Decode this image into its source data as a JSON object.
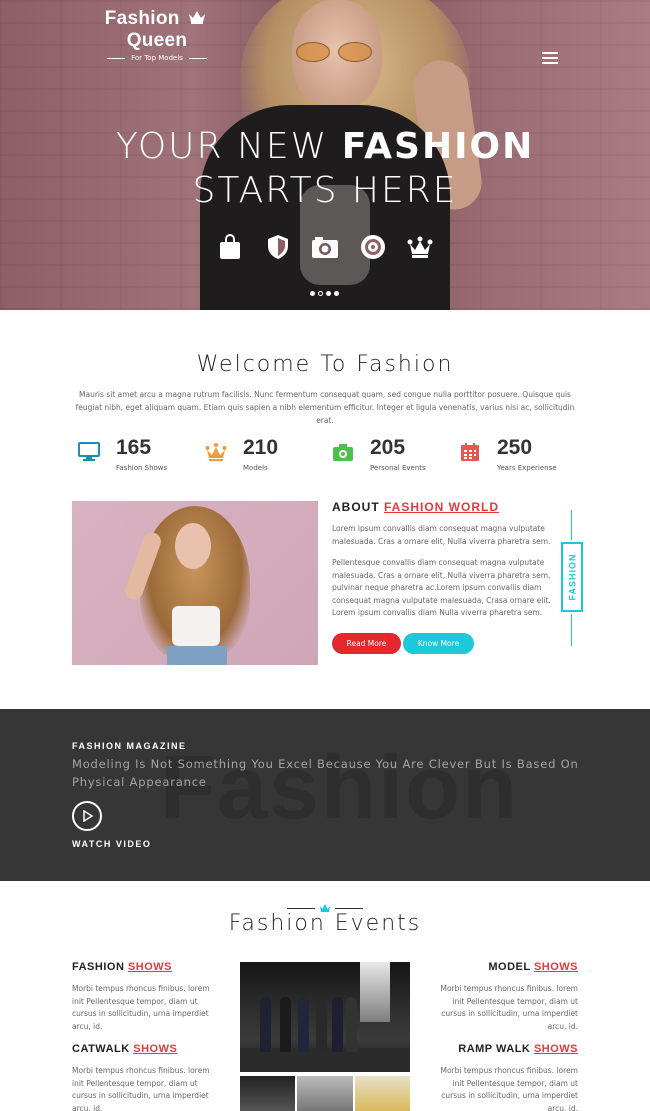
{
  "header": {
    "brand_left": "Fashion",
    "brand_right": "Queen",
    "tagline": "For Top Models"
  },
  "hero": {
    "title_line1_light": "YOUR NEW ",
    "title_line1_bold": "FASHION",
    "title_line2": "STARTS HERE",
    "icons": [
      "shopping-bag-icon",
      "shield-icon",
      "camera-icon",
      "target-icon",
      "crown-icon"
    ],
    "slides": 4,
    "active_slide": 2
  },
  "welcome": {
    "title": "Welcome To Fashion",
    "text": "Mauris sit amet arcu a magna rutrum facilisis. Nunc fermentum consequat quam, sed congue nulla porttitor posuere. Quisque quis feugiat nibh, eget aliquam quam. Etiam quis sapien a nibh elementum efficitur. Integer et ligula venenatis, varius nisi ac, sollicitudin erat."
  },
  "stats": [
    {
      "icon": "monitor-icon",
      "number": "165",
      "label": "Fashion Shows",
      "color": "#1b8db8"
    },
    {
      "icon": "crown-icon",
      "number": "210",
      "label": "Models",
      "color": "#f39c33"
    },
    {
      "icon": "camera-icon",
      "number": "205",
      "label": "Personal Events",
      "color": "#4cbf4f"
    },
    {
      "icon": "calendar-icon",
      "number": "250",
      "label": "Years Experiense",
      "color": "#e6584e"
    }
  ],
  "about": {
    "title_plain": "ABOUT ",
    "title_link": "FASHION WORLD",
    "para1": "Lorem ipsum convallis diam consequat magna vulputate malesuada. Cras a ornare elit, Nulla viverra pharetra sem.",
    "para2": "Pellentesque convallis diam consequat magna vulputate malesuada. Cras a ornare elit, Nulla viverra pharetra sem, pulvinar neque pharetra ac.Lorem ipsum convallis diam consequat magna vulputate malesuada, Crasa ornare elit. Lorem ipsum convallis diam Nulla viverra pharetra sem.",
    "read_more": "Read More",
    "know_more": "Know More",
    "side_label": "FASHION"
  },
  "magazine": {
    "kicker": "FASHION MAGAZINE",
    "text": "Modeling Is Not Something You Excel Because You Are Clever But Is Based On Physical Appearance",
    "watch": "WATCH VIDEO",
    "bg_word": "Fashion"
  },
  "events": {
    "title": "Fashion Events",
    "items": [
      {
        "plain": "FASHION ",
        "link": "SHOWS",
        "text": "Morbi tempus rhoncus finibus. lorem init Pellentesque tempor, diam ut cursus in sollicitudin, urna imperdiet arcu, id."
      },
      {
        "plain": "MODEL ",
        "link": "SHOWS",
        "text": "Morbi tempus rhoncus finibus. lorem init Pellentesque tempor, diam ut cursus in sollicitudin, urna imperdiet arcu, id."
      },
      {
        "plain": "CATWALK ",
        "link": "SHOWS",
        "text": "Morbi tempus rhoncus finibus. lorem init Pellentesque tempor, diam ut cursus in sollicitudin, urna imperdiet arcu, id."
      },
      {
        "plain": "RAMP WALK ",
        "link": "SHOWS",
        "text": "Morbi tempus rhoncus finibus. lorem init Pellentesque tempor, diam ut cursus in sollicitudin, urna imperdiet arcu, id."
      }
    ]
  },
  "colors": {
    "accent_red": "#e4282d",
    "accent_cyan": "#1cc8d9",
    "dark_band": "#363636"
  }
}
